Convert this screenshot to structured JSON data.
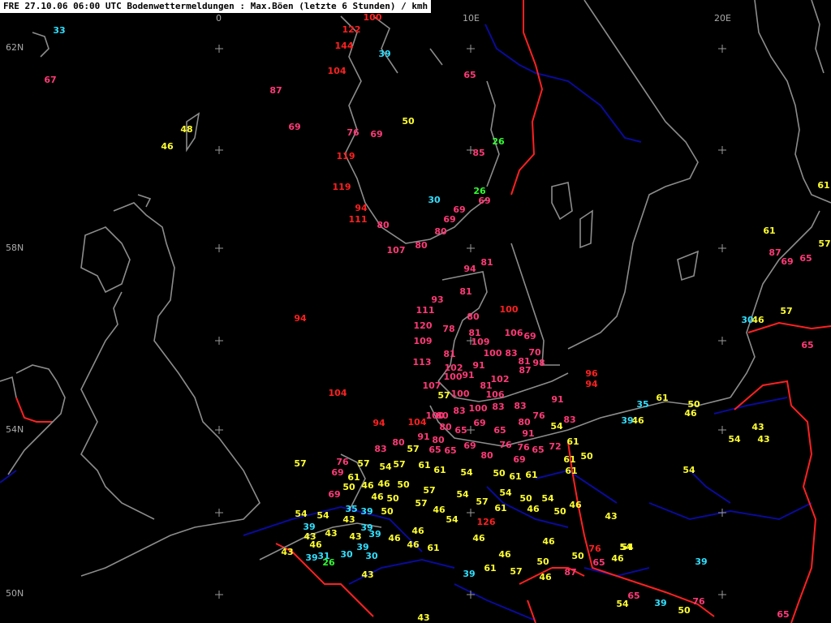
{
  "header": {
    "title": "FRE 27.10.06 06:00 UTC  Bodenwettermeldungen :  Max.Böen (letzte 6 Stunden) / kmh"
  },
  "colors": {
    "background": "#000000",
    "coast": "#8c8c8c",
    "border_red": "#ff2020",
    "border_blue": "#0a0a9a",
    "grid": "#9a9a9a",
    "v_red": "#ff2020",
    "v_pink": "#ff3a78",
    "v_yellow": "#ffff30",
    "v_cyan": "#30e0ff",
    "v_green": "#30ff30"
  },
  "grid_labels": {
    "lon": [
      "0",
      "10E",
      "20E"
    ],
    "lat": [
      "62N",
      "58N",
      "54N",
      "50N"
    ]
  },
  "observations": [
    {
      "v": "100",
      "c": "v_red"
    },
    {
      "v": "122",
      "c": "v_red"
    },
    {
      "v": "144",
      "c": "v_red"
    },
    {
      "v": "104",
      "c": "v_red"
    },
    {
      "v": "119",
      "c": "v_red"
    },
    {
      "v": "119",
      "c": "v_red"
    },
    {
      "v": "111",
      "c": "v_red"
    },
    {
      "v": "107",
      "c": "v_pink"
    },
    {
      "v": "33",
      "c": "v_cyan"
    },
    {
      "v": "67",
      "c": "v_pink"
    },
    {
      "v": "39",
      "c": "v_cyan"
    },
    {
      "v": "87",
      "c": "v_pink"
    },
    {
      "v": "69",
      "c": "v_pink"
    },
    {
      "v": "48",
      "c": "v_yellow"
    },
    {
      "v": "46",
      "c": "v_yellow"
    },
    {
      "v": "76",
      "c": "v_pink"
    },
    {
      "v": "69",
      "c": "v_pink"
    },
    {
      "v": "50",
      "c": "v_yellow"
    },
    {
      "v": "65",
      "c": "v_pink"
    },
    {
      "v": "85",
      "c": "v_pink"
    },
    {
      "v": "26",
      "c": "v_green"
    },
    {
      "v": "26",
      "c": "v_green"
    },
    {
      "v": "30",
      "c": "v_cyan"
    },
    {
      "v": "69",
      "c": "v_pink"
    },
    {
      "v": "94",
      "c": "v_red"
    },
    {
      "v": "80",
      "c": "v_pink"
    },
    {
      "v": "69",
      "c": "v_pink"
    },
    {
      "v": "69",
      "c": "v_pink"
    },
    {
      "v": "80",
      "c": "v_pink"
    },
    {
      "v": "80",
      "c": "v_pink"
    },
    {
      "v": "94",
      "c": "v_pink"
    },
    {
      "v": "81",
      "c": "v_pink"
    },
    {
      "v": "81",
      "c": "v_pink"
    },
    {
      "v": "93",
      "c": "v_pink"
    },
    {
      "v": "111",
      "c": "v_pink"
    },
    {
      "v": "100",
      "c": "v_red"
    },
    {
      "v": "80",
      "c": "v_pink"
    },
    {
      "v": "94",
      "c": "v_red"
    },
    {
      "v": "120",
      "c": "v_pink"
    },
    {
      "v": "78",
      "c": "v_pink"
    },
    {
      "v": "81",
      "c": "v_pink"
    },
    {
      "v": "106",
      "c": "v_pink"
    },
    {
      "v": "69",
      "c": "v_pink"
    },
    {
      "v": "109",
      "c": "v_pink"
    },
    {
      "v": "109",
      "c": "v_pink"
    },
    {
      "v": "81",
      "c": "v_pink"
    },
    {
      "v": "100",
      "c": "v_pink"
    },
    {
      "v": "83",
      "c": "v_pink"
    },
    {
      "v": "70",
      "c": "v_pink"
    },
    {
      "v": "113",
      "c": "v_pink"
    },
    {
      "v": "102",
      "c": "v_pink"
    },
    {
      "v": "91",
      "c": "v_pink"
    },
    {
      "v": "81",
      "c": "v_pink"
    },
    {
      "v": "98",
      "c": "v_pink"
    },
    {
      "v": "87",
      "c": "v_pink"
    },
    {
      "v": "100",
      "c": "v_pink"
    },
    {
      "v": "91",
      "c": "v_pink"
    },
    {
      "v": "102",
      "c": "v_pink"
    },
    {
      "v": "96",
      "c": "v_red"
    },
    {
      "v": "94",
      "c": "v_red"
    },
    {
      "v": "107",
      "c": "v_pink"
    },
    {
      "v": "81",
      "c": "v_pink"
    },
    {
      "v": "57",
      "c": "v_yellow"
    },
    {
      "v": "100",
      "c": "v_pink"
    },
    {
      "v": "106",
      "c": "v_pink"
    },
    {
      "v": "83",
      "c": "v_pink"
    },
    {
      "v": "104",
      "c": "v_red"
    },
    {
      "v": "100",
      "c": "v_pink"
    },
    {
      "v": "83",
      "c": "v_pink"
    },
    {
      "v": "100",
      "c": "v_pink"
    },
    {
      "v": "83",
      "c": "v_pink"
    },
    {
      "v": "91",
      "c": "v_pink"
    },
    {
      "v": "76",
      "c": "v_pink"
    },
    {
      "v": "80",
      "c": "v_pink"
    },
    {
      "v": "94",
      "c": "v_red"
    },
    {
      "v": "104",
      "c": "v_red"
    },
    {
      "v": "80",
      "c": "v_pink"
    },
    {
      "v": "65",
      "c": "v_pink"
    },
    {
      "v": "69",
      "c": "v_pink"
    },
    {
      "v": "91",
      "c": "v_pink"
    },
    {
      "v": "65",
      "c": "v_pink"
    },
    {
      "v": "54",
      "c": "v_yellow"
    },
    {
      "v": "83",
      "c": "v_pink"
    },
    {
      "v": "91",
      "c": "v_pink"
    },
    {
      "v": "80",
      "c": "v_pink"
    },
    {
      "v": "65",
      "c": "v_pink"
    },
    {
      "v": "65",
      "c": "v_pink"
    },
    {
      "v": "69",
      "c": "v_pink"
    },
    {
      "v": "76",
      "c": "v_pink"
    },
    {
      "v": "76",
      "c": "v_pink"
    },
    {
      "v": "65",
      "c": "v_pink"
    },
    {
      "v": "72",
      "c": "v_pink"
    },
    {
      "v": "61",
      "c": "v_yellow"
    },
    {
      "v": "83",
      "c": "v_pink"
    },
    {
      "v": "80",
      "c": "v_pink"
    },
    {
      "v": "57",
      "c": "v_yellow"
    },
    {
      "v": "80",
      "c": "v_pink"
    },
    {
      "v": "69",
      "c": "v_pink"
    },
    {
      "v": "61",
      "c": "v_yellow"
    },
    {
      "v": "50",
      "c": "v_yellow"
    },
    {
      "v": "57",
      "c": "v_yellow"
    },
    {
      "v": "76",
      "c": "v_pink"
    },
    {
      "v": "57",
      "c": "v_yellow"
    },
    {
      "v": "54",
      "c": "v_yellow"
    },
    {
      "v": "57",
      "c": "v_yellow"
    },
    {
      "v": "61",
      "c": "v_yellow"
    },
    {
      "v": "61",
      "c": "v_yellow"
    },
    {
      "v": "54",
      "c": "v_yellow"
    },
    {
      "v": "50",
      "c": "v_yellow"
    },
    {
      "v": "61",
      "c": "v_yellow"
    },
    {
      "v": "61",
      "c": "v_yellow"
    },
    {
      "v": "61",
      "c": "v_yellow"
    },
    {
      "v": "69",
      "c": "v_pink"
    },
    {
      "v": "61",
      "c": "v_yellow"
    },
    {
      "v": "50",
      "c": "v_yellow"
    },
    {
      "v": "46",
      "c": "v_yellow"
    },
    {
      "v": "46",
      "c": "v_yellow"
    },
    {
      "v": "50",
      "c": "v_yellow"
    },
    {
      "v": "57",
      "c": "v_yellow"
    },
    {
      "v": "54",
      "c": "v_yellow"
    },
    {
      "v": "54",
      "c": "v_yellow"
    },
    {
      "v": "69",
      "c": "v_pink"
    },
    {
      "v": "46",
      "c": "v_yellow"
    },
    {
      "v": "50",
      "c": "v_yellow"
    },
    {
      "v": "57",
      "c": "v_yellow"
    },
    {
      "v": "57",
      "c": "v_yellow"
    },
    {
      "v": "50",
      "c": "v_yellow"
    },
    {
      "v": "54",
      "c": "v_yellow"
    },
    {
      "v": "46",
      "c": "v_yellow"
    },
    {
      "v": "54",
      "c": "v_yellow"
    },
    {
      "v": "54",
      "c": "v_yellow"
    },
    {
      "v": "35",
      "c": "v_cyan"
    },
    {
      "v": "39",
      "c": "v_cyan"
    },
    {
      "v": "50",
      "c": "v_yellow"
    },
    {
      "v": "46",
      "c": "v_yellow"
    },
    {
      "v": "54",
      "c": "v_yellow"
    },
    {
      "v": "61",
      "c": "v_yellow"
    },
    {
      "v": "46",
      "c": "v_yellow"
    },
    {
      "v": "50",
      "c": "v_yellow"
    },
    {
      "v": "43",
      "c": "v_yellow"
    },
    {
      "v": "39",
      "c": "v_cyan"
    },
    {
      "v": "126",
      "c": "v_red"
    },
    {
      "v": "43",
      "c": "v_yellow"
    },
    {
      "v": "39",
      "c": "v_cyan"
    },
    {
      "v": "54",
      "c": "v_yellow"
    },
    {
      "v": "43",
      "c": "v_yellow"
    },
    {
      "v": "39",
      "c": "v_cyan"
    },
    {
      "v": "43",
      "c": "v_yellow"
    },
    {
      "v": "39",
      "c": "v_cyan"
    },
    {
      "v": "46",
      "c": "v_yellow"
    },
    {
      "v": "46",
      "c": "v_yellow"
    },
    {
      "v": "46",
      "c": "v_yellow"
    },
    {
      "v": "61",
      "c": "v_yellow"
    },
    {
      "v": "46",
      "c": "v_yellow"
    },
    {
      "v": "46",
      "c": "v_yellow"
    },
    {
      "v": "76",
      "c": "v_red"
    },
    {
      "v": "54",
      "c": "v_yellow"
    },
    {
      "v": "43",
      "c": "v_yellow"
    },
    {
      "v": "46",
      "c": "v_yellow"
    },
    {
      "v": "31",
      "c": "v_cyan"
    },
    {
      "v": "43",
      "c": "v_yellow"
    },
    {
      "v": "39",
      "c": "v_cyan"
    },
    {
      "v": "26",
      "c": "v_green"
    },
    {
      "v": "30",
      "c": "v_cyan"
    },
    {
      "v": "30",
      "c": "v_cyan"
    },
    {
      "v": "46",
      "c": "v_yellow"
    },
    {
      "v": "50",
      "c": "v_yellow"
    },
    {
      "v": "50",
      "c": "v_yellow"
    },
    {
      "v": "65",
      "c": "v_pink"
    },
    {
      "v": "46",
      "c": "v_yellow"
    },
    {
      "v": "39",
      "c": "v_cyan"
    },
    {
      "v": "43",
      "c": "v_yellow"
    },
    {
      "v": "39",
      "c": "v_cyan"
    },
    {
      "v": "61",
      "c": "v_yellow"
    },
    {
      "v": "57",
      "c": "v_yellow"
    },
    {
      "v": "46",
      "c": "v_yellow"
    },
    {
      "v": "87",
      "c": "v_pink"
    },
    {
      "v": "54",
      "c": "v_yellow"
    },
    {
      "v": "65",
      "c": "v_pink"
    },
    {
      "v": "39",
      "c": "v_cyan"
    },
    {
      "v": "50",
      "c": "v_yellow"
    },
    {
      "v": "76",
      "c": "v_pink"
    },
    {
      "v": "65",
      "c": "v_pink"
    },
    {
      "v": "43",
      "c": "v_yellow"
    },
    {
      "v": "46",
      "c": "v_yellow"
    },
    {
      "v": "61",
      "c": "v_yellow"
    },
    {
      "v": "50",
      "c": "v_yellow"
    },
    {
      "v": "46",
      "c": "v_yellow"
    },
    {
      "v": "39",
      "c": "v_cyan"
    },
    {
      "v": "54",
      "c": "v_yellow"
    },
    {
      "v": "43",
      "c": "v_yellow"
    },
    {
      "v": "43",
      "c": "v_yellow"
    },
    {
      "v": "54",
      "c": "v_yellow"
    },
    {
      "v": "35",
      "c": "v_cyan"
    },
    {
      "v": "30",
      "c": "v_cyan"
    },
    {
      "v": "61",
      "c": "v_yellow"
    },
    {
      "v": "65",
      "c": "v_pink"
    },
    {
      "v": "61",
      "c": "v_yellow"
    },
    {
      "v": "57",
      "c": "v_yellow"
    },
    {
      "v": "87",
      "c": "v_pink"
    },
    {
      "v": "80",
      "c": "v_pink"
    },
    {
      "v": "69",
      "c": "v_pink"
    },
    {
      "v": "46",
      "c": "v_yellow"
    },
    {
      "v": "57",
      "c": "v_yellow"
    },
    {
      "v": "65",
      "c": "v_pink"
    },
    {
      "v": "43",
      "c": "v_yellow"
    },
    {
      "v": "39",
      "c": "v_cyan"
    }
  ]
}
